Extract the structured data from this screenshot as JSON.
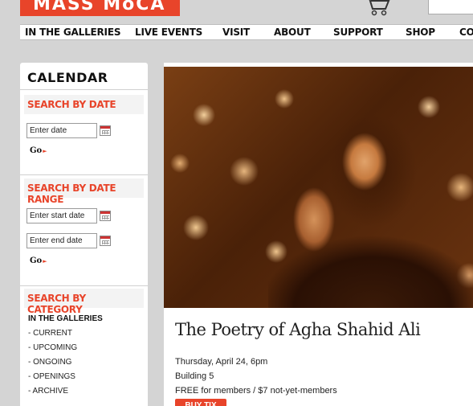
{
  "header": {
    "logo_text": "MASS MoCA",
    "nav": [
      {
        "label": "IN THE GALLERIES"
      },
      {
        "label": "LIVE EVENTS"
      },
      {
        "label": "VISIT"
      },
      {
        "label": "ABOUT"
      },
      {
        "label": "SUPPORT"
      },
      {
        "label": "SHOP"
      },
      {
        "label": "CO"
      }
    ],
    "icons": {
      "cart": "shopping-cart-icon"
    }
  },
  "sidebar": {
    "title": "CALENDAR",
    "search_by_date": {
      "heading": "SEARCH BY DATE",
      "date_placeholder": "Enter date",
      "go_label": "Go"
    },
    "search_by_range": {
      "heading": "SEARCH BY DATE RANGE",
      "start_placeholder": "Enter start date",
      "end_placeholder": "Enter end date",
      "go_label": "Go"
    },
    "search_by_category": {
      "heading": "SEARCH BY CATEGORY",
      "group_label": "IN THE GALLERIES",
      "items": [
        {
          "label": "- CURRENT"
        },
        {
          "label": "- UPCOMING"
        },
        {
          "label": "- ONGOING"
        },
        {
          "label": "- OPENINGS"
        },
        {
          "label": "- ARCHIVE"
        }
      ]
    }
  },
  "event": {
    "title": "The Poetry of Agha Shahid Ali",
    "date": "Thursday, April 24, 6pm",
    "location": "Building 5",
    "price": "FREE for members / $7 not-yet-members",
    "buy_label": "BUY TIX"
  },
  "colors": {
    "accent": "#e8442a",
    "background": "#d4d4d4"
  }
}
